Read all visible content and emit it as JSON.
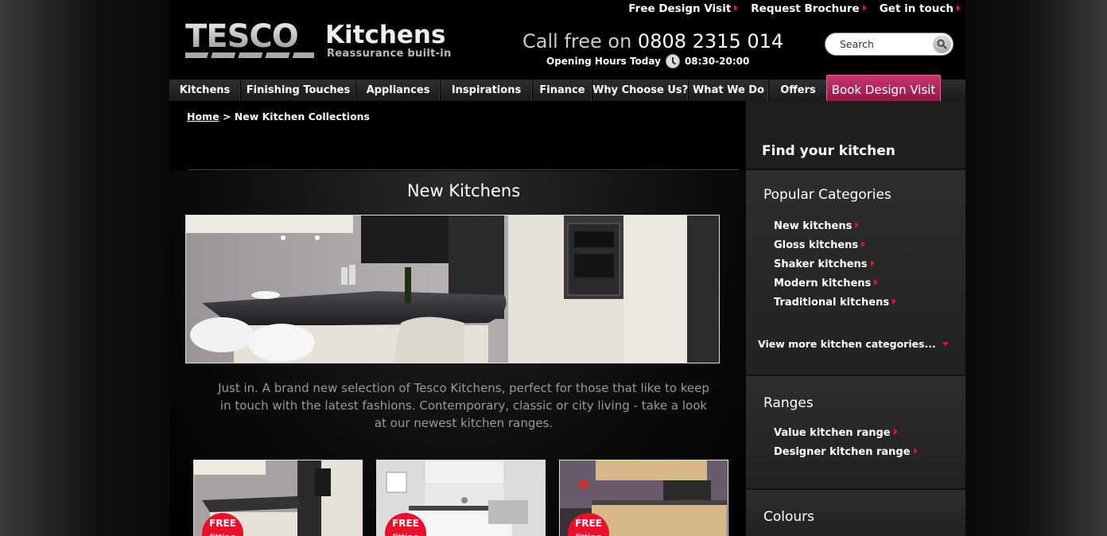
{
  "top_links": [
    "Free Design Visit",
    "Request Brochure",
    "Get in touch"
  ],
  "logo": {
    "brand": "TESCO",
    "word": "Kitchens",
    "tagline": "Reassurance built-in"
  },
  "phone": {
    "prefix": "Call free on",
    "number": "0808 2315 014"
  },
  "hours": {
    "label": "Opening Hours Today",
    "time": "08:30-20:00"
  },
  "search": {
    "placeholder": "Search"
  },
  "nav": [
    "Kitchens",
    "Finishing Touches",
    "Appliances",
    "Inspirations",
    "Finance",
    "Why Choose Us?",
    "What We Do",
    "Offers"
  ],
  "book_button": "Book Design Visit",
  "breadcrumb": {
    "home": "Home",
    "sep": ">",
    "current": "New Kitchen Collections"
  },
  "main": {
    "title": "New Kitchens",
    "intro": "Just in. A brand new selection of Tesco Kitchens, perfect for those that like to keep in touch with the latest fashions. Contemporary, classic or city living - take a look at our newest kitchen ranges.",
    "badge": {
      "line1": "FREE",
      "line2": "fitting"
    }
  },
  "sidebar": {
    "header": "Find your kitchen",
    "popular": {
      "title": "Popular Categories",
      "items": [
        "New kitchens",
        "Gloss kitchens",
        "Shaker kitchens",
        "Modern kitchens",
        "Traditional kitchens"
      ],
      "more": "View more kitchen categories..."
    },
    "ranges": {
      "title": "Ranges",
      "items": [
        "Value kitchen range",
        "Designer kitchen range"
      ]
    },
    "colours": {
      "title": "Colours"
    }
  },
  "colors": {
    "accent_red": "#e8102a",
    "book_pink": "#b02a60",
    "background": "#000000"
  }
}
